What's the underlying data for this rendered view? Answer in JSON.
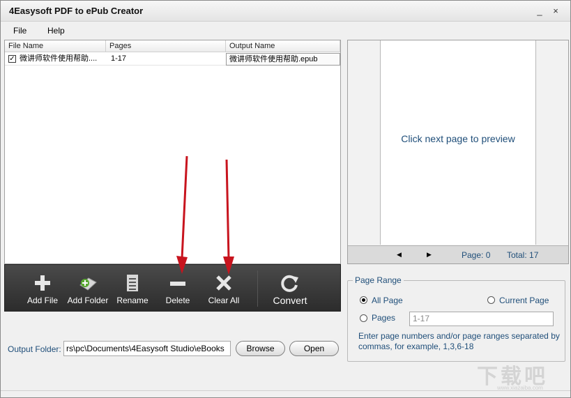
{
  "window": {
    "title": "4Easysoft PDF to ePub Creator"
  },
  "menu": {
    "file": "File",
    "help": "Help"
  },
  "table": {
    "columns": [
      "File Name",
      "Pages",
      "Output Name"
    ],
    "rows": [
      {
        "checked": true,
        "file_name": "微讲师软件使用帮助....",
        "pages": "1-17",
        "output_name": "微讲师软件使用帮助.epub"
      }
    ]
  },
  "toolbar": {
    "add_file": "Add File",
    "add_folder": "Add Folder",
    "rename": "Rename",
    "delete": "Delete",
    "clear_all": "Clear All",
    "convert": "Convert"
  },
  "preview": {
    "message": "Click next page to preview",
    "page_label": "Page: 0",
    "total_label": "Total: 17"
  },
  "page_range": {
    "legend": "Page Range",
    "all_page": "All Page",
    "current_page": "Current Page",
    "pages": "Pages",
    "selected": "all_page",
    "pages_value": "1-17",
    "hint": "Enter page numbers and/or page ranges separated by commas, for example, 1,3,6-18"
  },
  "output": {
    "label": "Output Folder:",
    "path": "rs\\pc\\Documents\\4Easysoft Studio\\eBooks",
    "browse": "Browse",
    "open": "Open"
  },
  "watermark": {
    "text": "下载吧",
    "sub": "www.xiazaiba.com"
  },
  "colors": {
    "accent_text": "#1f4e79",
    "toolbar_bg": "#3a3a3a",
    "arrow": "#c8141e"
  }
}
